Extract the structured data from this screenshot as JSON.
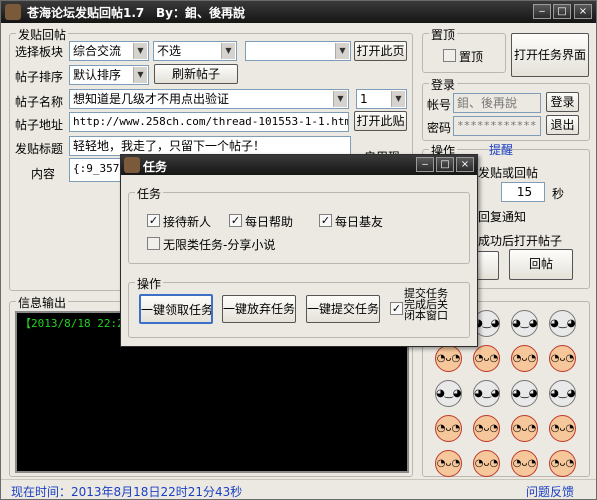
{
  "window": {
    "title": "苍海论坛发贴回帖1.7",
    "author": "By：鉬、後再說",
    "controls": [
      "minimize-icon",
      "maximize-icon",
      "close-icon"
    ]
  },
  "post_group": {
    "legend": "发贴回帖",
    "board_label": "选择板块",
    "board_value": "综合交流",
    "sub_board_value": "不选",
    "third_select_value": "",
    "open_page_button": "打开此页",
    "sort_label": "帖子排序",
    "sort_value": "默认排序",
    "refresh_button": "刷新帖子",
    "name_label": "帖子名称",
    "name_value": "想知道是几级才不用点出验证",
    "page_number": "1",
    "url_label": "帖子地址",
    "url_value": "http://www.258ch.com/thread-101553-1-1.html",
    "open_url_button": "打开此贴",
    "post_title_label": "发贴标题",
    "post_title_value": "轻轻地，我走了，只留下一个帖子！",
    "content_label": "内容",
    "content_value": "{:9_357:",
    "partial_label": "启用现"
  },
  "pin_group": {
    "legend": "置顶",
    "pin_checkbox_label": "置顶",
    "open_task_button": "打开任务界面"
  },
  "login_group": {
    "legend": "登录",
    "account_label": "帐号",
    "account_value": "鉬、後再說",
    "login_button": "登录",
    "password_label": "密码",
    "password_value": "************",
    "logout_button": "退出"
  },
  "operate_group": {
    "legend": "操作",
    "remind_link": "提醒",
    "partial_post_reply": "发贴或回帖",
    "count_value": "15",
    "seconds_label": "秒",
    "partial_reply_notice": "回复通知",
    "partial_open_after": "成功后打开帖子",
    "reply_button": "回帖"
  },
  "info_group": {
    "legend": "信息输出",
    "log_line": "【2013/8/18 22:21"
  },
  "status": {
    "current_time": "现在时间：2013年8月18日22时21分43秒",
    "feedback_link": "问题反馈"
  },
  "emoticons": [
    "panda-1",
    "panda-2",
    "panda-3",
    "panda-4",
    "onion-1",
    "onion-2",
    "onion-3",
    "onion-4",
    "panda-5",
    "panda-6",
    "panda-7",
    "panda-8",
    "onion-5",
    "onion-6",
    "onion-7",
    "onion-8",
    "onion-9",
    "onion-10",
    "onion-11",
    "onion-12"
  ],
  "task_dialog": {
    "title": "任务",
    "task_legend": "任务",
    "receive_new_label": "接待新人",
    "receive_new_checked": true,
    "daily_help_label": "每日帮助",
    "daily_help_checked": true,
    "daily_friend_label": "每日基友",
    "daily_friend_checked": true,
    "unlimited_label": "无限类任务-分享小说",
    "unlimited_checked": false,
    "op_legend": "操作",
    "claim_all_button": "一键领取任务",
    "abandon_all_button": "一键放弃任务",
    "submit_all_button": "一键提交任务",
    "submit_close_line1": "提交任务",
    "submit_close_line2": "完成后关",
    "submit_close_line3": "闭本窗口",
    "submit_close_checked": true
  }
}
